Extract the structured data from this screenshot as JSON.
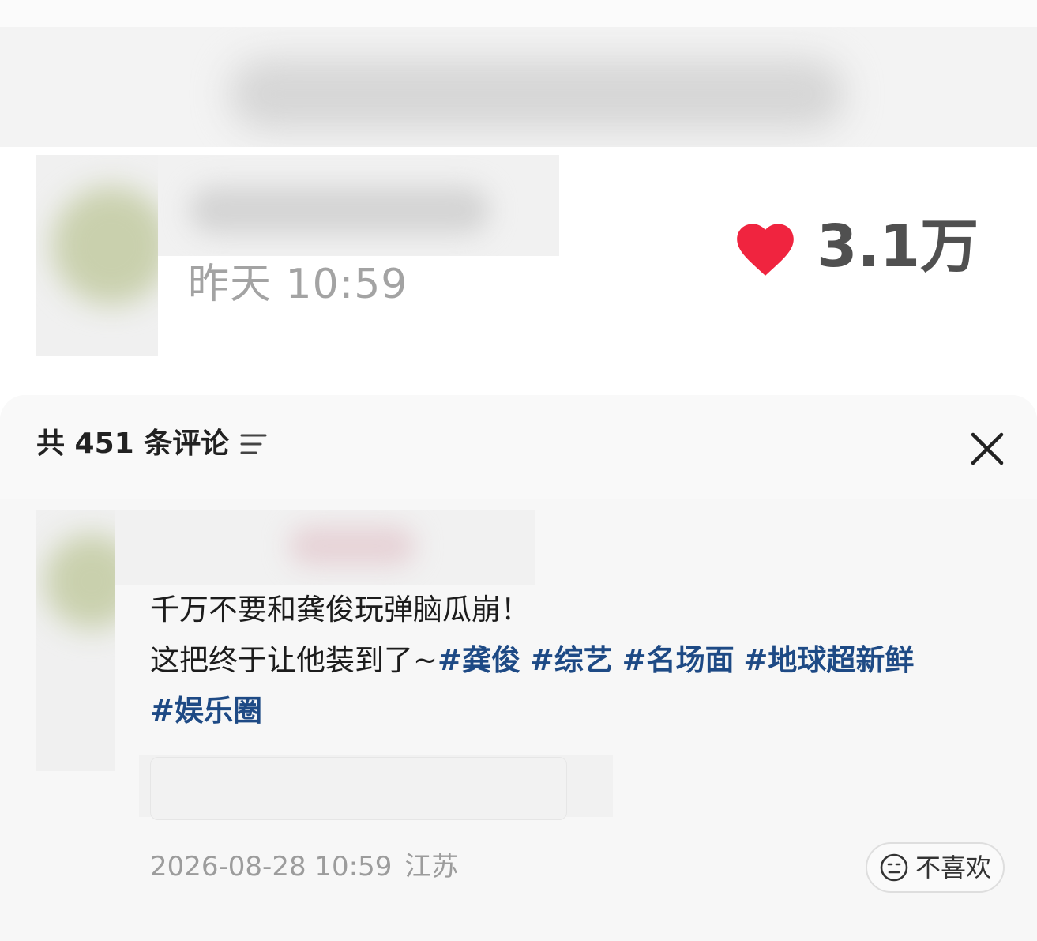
{
  "post": {
    "time": "昨天 10:59",
    "like_count": "3.1万",
    "like_color": "#f0243f"
  },
  "comments_panel": {
    "title": "共 451 条评论",
    "filter_icon": "filter-lines-icon",
    "close_icon": "close-icon"
  },
  "comment": {
    "text_line1": "千万不要和龚俊玩弹脑瓜崩！",
    "text_line2": "这把终于让他装到了~",
    "hashtags": [
      "#龚俊",
      "#综艺",
      "#名场面",
      "#地球超新鲜",
      "#娱乐圈"
    ],
    "hashtag_color": "#1e4a85",
    "timestamp": "2026-08-28 10:59",
    "location": "江苏",
    "dislike_label": "不喜欢",
    "dislike_icon": "meh-face-icon"
  }
}
